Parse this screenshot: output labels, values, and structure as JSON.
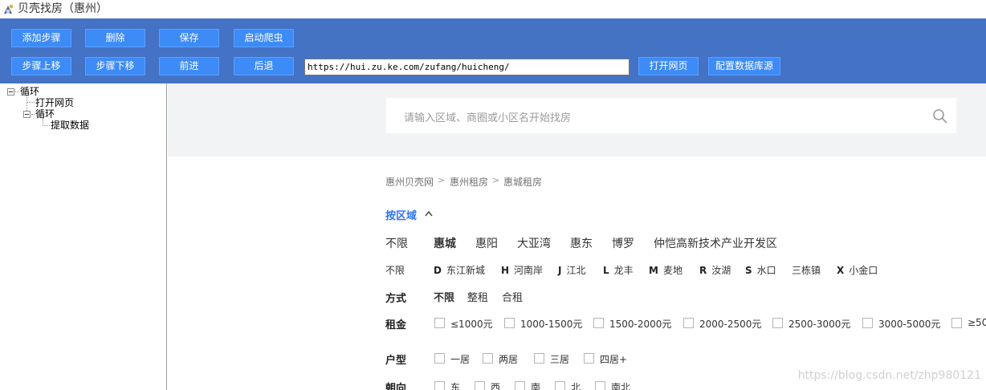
{
  "window": {
    "title": "贝壳找房（惠州）"
  },
  "toolbar": {
    "row1": [
      "添加步骤",
      "删除",
      "保存",
      "启动爬虫"
    ],
    "row2": [
      "步骤上移",
      "步骤下移",
      "前进",
      "后退"
    ],
    "url": "https://hui.zu.ke.com/zufang/huicheng/",
    "open_page": "打开网页",
    "config_db": "配置数据库源",
    "accent": "#4472c4",
    "button_color": "#3d8bf7"
  },
  "tree": {
    "root": "循环",
    "child1": "打开网页",
    "child2": "循环",
    "grandchild": "提取数据"
  },
  "web": {
    "search_placeholder": "请输入区域、商圈或小区名开始找房",
    "breadcrumb": [
      "惠州贝壳网",
      "惠州租房",
      "惠城租房"
    ],
    "breadcrumb_sep": ">",
    "by_region": "按区域",
    "regions": [
      "不限",
      "惠城",
      "惠阳",
      "大亚湾",
      "惠东",
      "博罗",
      "仲恺高新技术产业开发区"
    ],
    "subareas_all": "不限",
    "subareas": [
      {
        "letter": "D",
        "name": "东江新城"
      },
      {
        "letter": "H",
        "name": "河南岸"
      },
      {
        "letter": "J",
        "name": "江北"
      },
      {
        "letter": "L",
        "name": "龙丰"
      },
      {
        "letter": "M",
        "name": "麦地"
      },
      {
        "letter": "R",
        "name": "汝湖"
      },
      {
        "letter": "S",
        "name": "水口"
      },
      {
        "letter": "",
        "name": "三栋镇"
      },
      {
        "letter": "X",
        "name": "小金口"
      }
    ],
    "mode_label": "方式",
    "modes": [
      "不限",
      "整租",
      "合租"
    ],
    "rent_label": "租金",
    "rents": [
      "≤1000元",
      "1000-1500元",
      "1500-2000元",
      "2000-2500元",
      "2500-3000元",
      "3000-5000元",
      "≥50"
    ],
    "layout_label": "户型",
    "layouts": [
      "一居",
      "两居",
      "三居",
      "四居+"
    ],
    "orient_label": "朝向",
    "orients": [
      "东",
      "西",
      "南",
      "北",
      "南北"
    ],
    "watermark": "https://blog.csdn.net/zhp980121",
    "active_color": "#3072f6"
  }
}
